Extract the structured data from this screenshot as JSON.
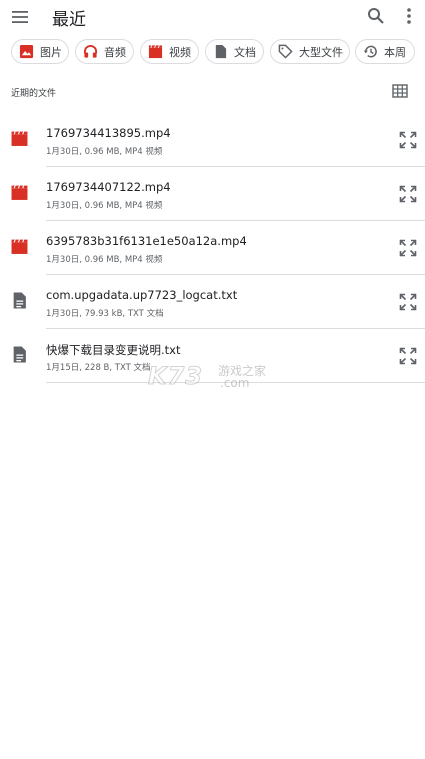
{
  "appbar": {
    "title": "最近",
    "menu_icon": "menu-icon",
    "search_icon": "search-icon",
    "more_icon": "more-vert-icon"
  },
  "chips": [
    {
      "label": "图片",
      "icon": "image-icon",
      "color": "#d93025"
    },
    {
      "label": "音频",
      "icon": "headphones-icon",
      "color": "#d93025"
    },
    {
      "label": "视频",
      "icon": "video-icon",
      "color": "#d93025"
    },
    {
      "label": "文档",
      "icon": "document-icon",
      "color": "#5f6368"
    },
    {
      "label": "大型文件",
      "icon": "tag-icon",
      "color": "#5f6368"
    },
    {
      "label": "本周",
      "icon": "history-icon",
      "color": "#5f6368"
    }
  ],
  "recent": {
    "label": "近期的文件",
    "grid_icon": "grid-view-icon"
  },
  "files": [
    {
      "name": "1769734413895.mp4",
      "meta": "1月30日, 0.96 MB, MP4 视频",
      "icon": "video-file-icon"
    },
    {
      "name": "1769734407122.mp4",
      "meta": "1月30日, 0.96 MB, MP4 视频",
      "icon": "video-file-icon"
    },
    {
      "name": "6395783b31f6131e1e50a12a.mp4",
      "meta": "1月30日, 0.96 MB, MP4 视频",
      "icon": "video-file-icon"
    },
    {
      "name": "com.upgadata.up7723_logcat.txt",
      "meta": "1月30日, 79.93 kB, TXT 文档",
      "icon": "text-file-icon"
    },
    {
      "name": "快爆下载目录变更说明.txt",
      "meta": "1月15日, 228 B, TXT 文档",
      "icon": "text-file-icon"
    }
  ],
  "watermark": {
    "text": "K73",
    "sub1": "游戏之家",
    "sub2": ".com"
  },
  "colors": {
    "video_red": "#d93025",
    "icon_gray": "#5f6368",
    "divider": "#dadce0"
  }
}
